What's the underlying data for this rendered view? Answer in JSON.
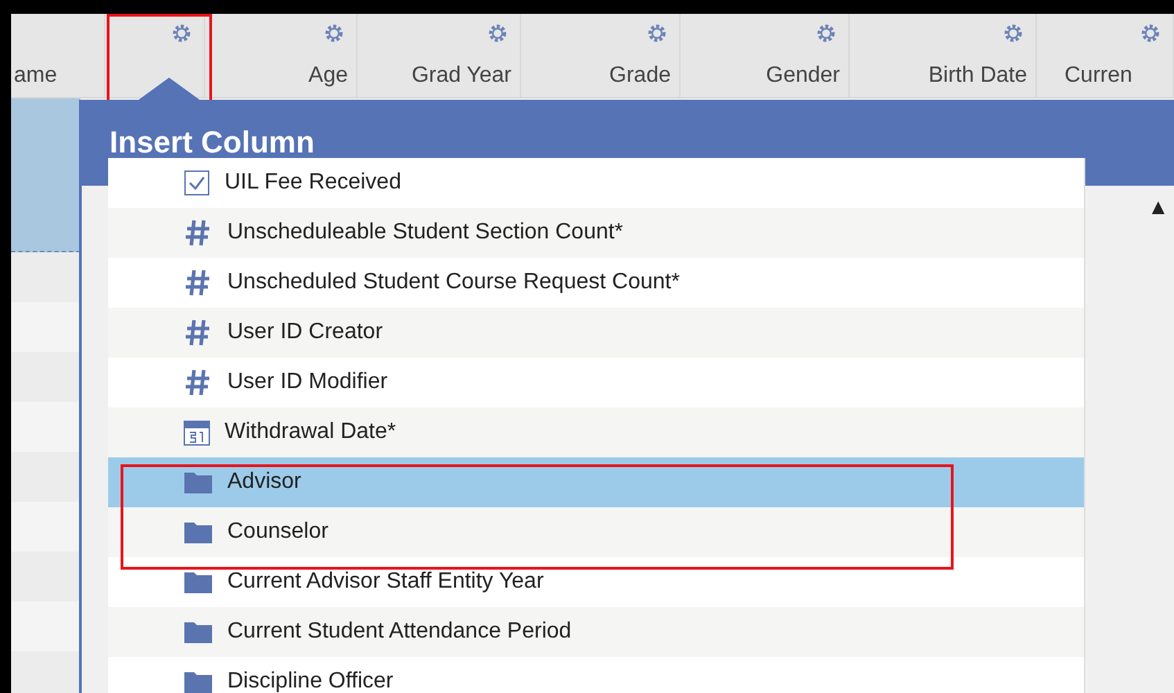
{
  "columns": [
    {
      "label": "ame",
      "gear": false
    },
    {
      "gear": true
    },
    {
      "label": "Age",
      "gear": true
    },
    {
      "label": "Grad Year",
      "gear": true
    },
    {
      "label": "Grade",
      "gear": true
    },
    {
      "label": "Gender",
      "gear": true
    },
    {
      "label": "Birth Date",
      "gear": true
    },
    {
      "label": "Curren",
      "gear": true
    }
  ],
  "popup": {
    "title": "Insert Column",
    "items": [
      {
        "kind": "checkbox",
        "label": "UIL Fee Received",
        "selected": false
      },
      {
        "kind": "number",
        "label": "Unscheduleable Student Section Count*",
        "selected": false
      },
      {
        "kind": "number",
        "label": "Unscheduled Student Course Request Count*",
        "selected": false
      },
      {
        "kind": "number",
        "label": "User ID Creator",
        "selected": false
      },
      {
        "kind": "number",
        "label": "User ID Modifier",
        "selected": false
      },
      {
        "kind": "date",
        "label": "Withdrawal Date*",
        "selected": false
      },
      {
        "kind": "folder",
        "label": "Advisor",
        "selected": true
      },
      {
        "kind": "folder",
        "label": "Counselor",
        "selected": false
      },
      {
        "kind": "folder",
        "label": "Current Advisor Staff Entity Year",
        "selected": false
      },
      {
        "kind": "folder",
        "label": "Current Student Attendance Period",
        "selected": false
      },
      {
        "kind": "folder",
        "label": "Discipline Officer",
        "selected": false
      }
    ],
    "scroll_up": "▲"
  }
}
